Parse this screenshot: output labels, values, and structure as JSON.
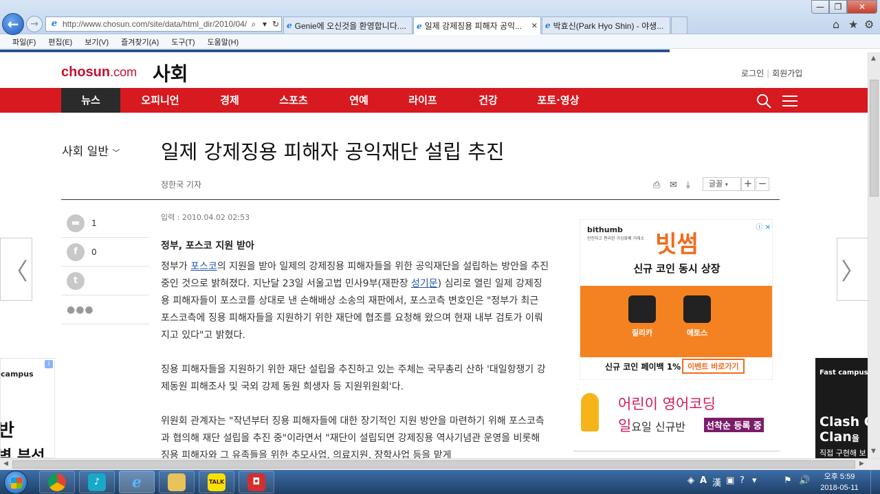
{
  "browser": {
    "address": "http://www.chosun.com/site/data/html_dir/2010/04/",
    "tabs": [
      {
        "label": "Genie에 오신것을 환영합니다...."
      },
      {
        "label": "일제 강제징용 피해자 공익...",
        "close": "✕"
      },
      {
        "label": "박효신(Park Hyo Shin) - 야생..."
      }
    ],
    "menu": [
      "파일(F)",
      "편집(E)",
      "보기(V)",
      "즐겨찾기(A)",
      "도구(T)",
      "도움말(H)"
    ]
  },
  "site": {
    "logo": "chosun",
    "logo_suffix": ".com",
    "section_logo": "사회",
    "login": "로그인",
    "join": "회원가입",
    "nav": [
      "뉴스",
      "오피니언",
      "경제",
      "스포츠",
      "연예",
      "라이프",
      "건강",
      "포토·영상"
    ]
  },
  "article": {
    "section": "사회 일반",
    "title": "일제 강제징용 피해자 공익재단 설립 추진",
    "reporter": "정한국 기자",
    "font_label": "글꼴",
    "published": "입력 : 2010.04.02 02:53",
    "subtitle": "정부, 포스코 지원 받아",
    "share": {
      "comments": "1",
      "facebook": "0"
    },
    "p1_a": "정부가 ",
    "p1_link1": "포스코",
    "p1_b": "의 지원을 받아 일제의 강제징용 피해자들을 위한 공익재단을 설립하는 방안을 추진 중인 것으로 밝혀졌다. 지난달 23일 서울고법 민사9부(재판장 ",
    "p1_link2": "성기문",
    "p1_c": ") 심리로 열린 일제 강제징용 피해자들이 포스코를 상대로 낸 손해배상 소송의 재판에서, 포스코측 변호인은 \"정부가 최근 포스코측에 징용 피해자들을 지원하기 위한 재단에 협조를 요청해 왔으며 현재 내부 검토가 이뤄지고 있다\"고 밝혔다.",
    "p2": "징용 피해자들을 지원하기 위한 재단 설립을 추진하고 있는 주체는 국무총리 산하 '대일항쟁기 강제동원 피해조사 및 국외 강제 동원 희생자 등 지원위원회'다.",
    "p3": "위원회 관계자는 \"작년부터 징용 피해자들에 대한 장기적인 지원 방안을 마련하기 위해 포스코측과 협의해 재단 설립을 추진 중\"이라면서 \"재단이 설립되면 강제징용 역사기념관 운영을 비롯해 징용 피해자와 그 유족들을 위한 추모사업, 의료지원, 장학사업 등을 맡게"
  },
  "ads": {
    "bithumb": {
      "brand": "bithumb",
      "brand_sub": "안전하고 편리한 가상화폐 거래소",
      "headline": "빗썸",
      "sub": "신규 코인 동시 상장",
      "coin1": "질리카",
      "coin2": "에토스",
      "bottom": "신규 코인 페이백 1%",
      "cta": "이벤트 바로가기"
    },
    "coding": {
      "line1": "어린이 영어코딩",
      "line2_em": "일",
      "line2": "요일 신규반",
      "badge": "선착순 등록 중"
    },
    "left": {
      "brand": "campus",
      "t2": "반",
      "t3": "벽 부선"
    },
    "right": {
      "brand": "Fast campus",
      "c1": "Clash C",
      "c2": "Clan",
      "c2_suffix": "을",
      "c3": "직접 구현해 보"
    }
  },
  "taskbar": {
    "time": "오후 5:59",
    "date": "2018-05-11",
    "ime": "A",
    "hanja": "漢"
  },
  "colors": {
    "brand_red": "#d71920",
    "logo_red": "#c8102e",
    "nav_active": "#2b2b2b"
  }
}
